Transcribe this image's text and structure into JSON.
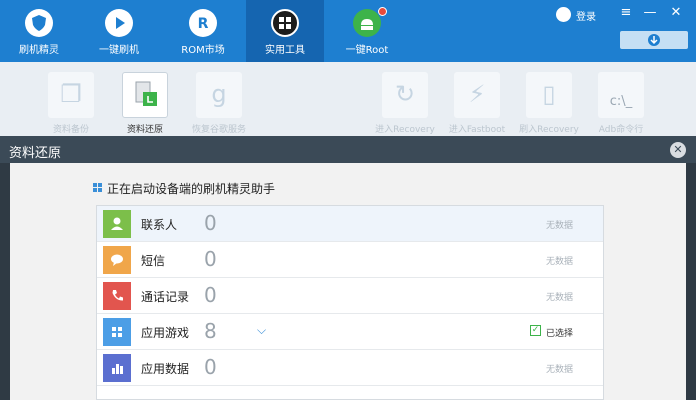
{
  "nav": {
    "items": [
      {
        "label": "刷机精灵",
        "icon": "shield-icon"
      },
      {
        "label": "一键刷机",
        "icon": "play-icon"
      },
      {
        "label": "ROM市场",
        "icon": "rom-icon"
      },
      {
        "label": "实用工具",
        "icon": "grid-icon"
      },
      {
        "label": "一键Root",
        "icon": "android-icon"
      }
    ],
    "login": "登录"
  },
  "toolbar": {
    "items": [
      {
        "label": "资料备份",
        "glyph": "❐"
      },
      {
        "label": "资料还原",
        "glyph": "▤"
      },
      {
        "label": "恢复谷歌服务",
        "glyph": "g"
      },
      {
        "label": "进入Recovery",
        "glyph": "↻"
      },
      {
        "label": "进入Fastboot",
        "glyph": "⚡"
      },
      {
        "label": "刷入Recovery",
        "glyph": "▯"
      },
      {
        "label": "Adb命令行",
        "glyph": "c:\\_"
      }
    ]
  },
  "dialog": {
    "title": "资料还原",
    "heading": "正在启动设备端的刷机精灵助手",
    "rows": [
      {
        "label": "联系人",
        "count": "0",
        "status": "无数据",
        "color": "#7cbf4a",
        "icon": "contact-icon"
      },
      {
        "label": "短信",
        "count": "0",
        "status": "无数据",
        "color": "#f0a64a",
        "icon": "sms-icon"
      },
      {
        "label": "通话记录",
        "count": "0",
        "status": "无数据",
        "color": "#e2554e",
        "icon": "phone-icon"
      },
      {
        "label": "应用游戏",
        "count": "8",
        "status": "已选择",
        "color": "#4c9ee6",
        "icon": "apps-icon"
      },
      {
        "label": "应用数据",
        "count": "0",
        "status": "无数据",
        "color": "#5b6fd0",
        "icon": "chart-icon"
      }
    ]
  }
}
